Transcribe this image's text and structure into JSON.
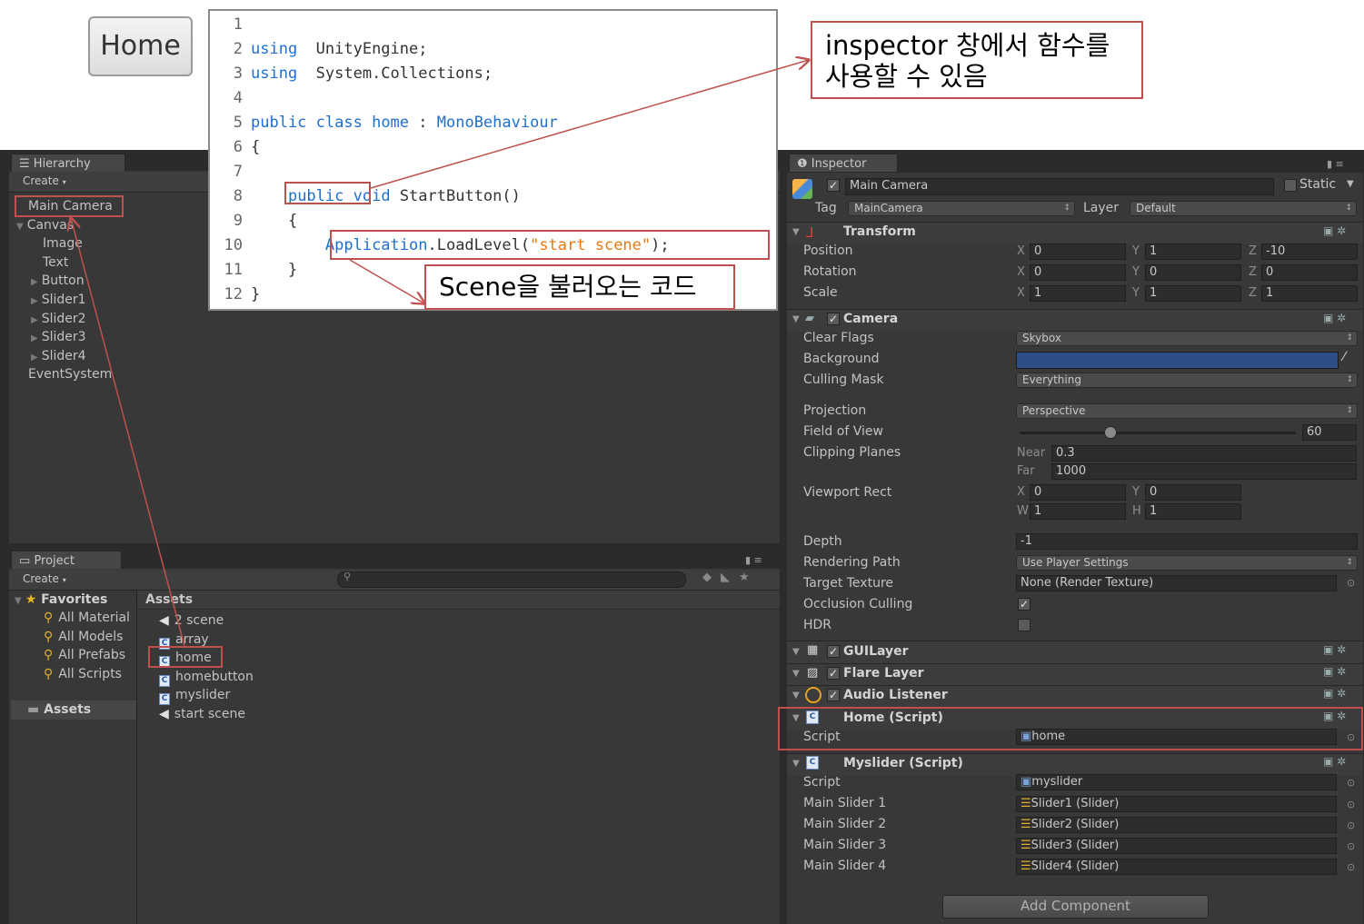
{
  "home_button": {
    "label": "Home"
  },
  "code": {
    "lines": [
      {
        "n": "1",
        "parts": []
      },
      {
        "n": "2",
        "parts": [
          [
            "kw",
            "using"
          ],
          [
            "",
            "  UnityEngine;"
          ]
        ]
      },
      {
        "n": "3",
        "parts": [
          [
            "kw",
            "using"
          ],
          [
            "",
            "  System.Collections;"
          ]
        ]
      },
      {
        "n": "4",
        "parts": []
      },
      {
        "n": "5",
        "parts": [
          [
            "kw",
            "public class"
          ],
          [
            "",
            " "
          ],
          [
            "ty",
            "home"
          ],
          [
            "",
            " : "
          ],
          [
            "ty",
            "MonoBehaviour"
          ]
        ]
      },
      {
        "n": "6",
        "parts": [
          [
            "",
            "{"
          ]
        ]
      },
      {
        "n": "7",
        "parts": []
      },
      {
        "n": "8",
        "parts": [
          [
            "",
            "    "
          ],
          [
            "kw",
            "public"
          ],
          [
            "",
            " "
          ],
          [
            "kw",
            "void"
          ],
          [
            "",
            " StartButton()"
          ]
        ]
      },
      {
        "n": "9",
        "parts": [
          [
            "",
            "    {"
          ]
        ]
      },
      {
        "n": "10",
        "parts": [
          [
            "",
            "        "
          ],
          [
            "ty",
            "Application"
          ],
          [
            "",
            ".LoadLevel("
          ],
          [
            "str",
            "\"start scene\""
          ],
          [
            "",
            ");"
          ]
        ]
      },
      {
        "n": "11",
        "parts": [
          [
            "",
            "    }"
          ]
        ]
      },
      {
        "n": "12",
        "parts": [
          [
            "",
            "}"
          ]
        ]
      }
    ]
  },
  "notes": {
    "inspector_note": "inspector 창에서 함수를\n사용할 수 있음",
    "scene_note": "Scene을 불러오는 코드"
  },
  "hierarchy": {
    "tab": "Hierarchy",
    "create": "Create",
    "items": [
      {
        "label": "Main Camera",
        "indent": 0,
        "arrow": ""
      },
      {
        "label": "Canvas",
        "indent": 0,
        "arrow": "▼"
      },
      {
        "label": "Image",
        "indent": 1,
        "arrow": ""
      },
      {
        "label": "Text",
        "indent": 1,
        "arrow": ""
      },
      {
        "label": "Button",
        "indent": 1,
        "arrow": "▶"
      },
      {
        "label": "Slider1",
        "indent": 1,
        "arrow": "▶"
      },
      {
        "label": "Slider2",
        "indent": 1,
        "arrow": "▶"
      },
      {
        "label": "Slider3",
        "indent": 1,
        "arrow": "▶"
      },
      {
        "label": "Slider4",
        "indent": 1,
        "arrow": "▶"
      },
      {
        "label": "EventSystem",
        "indent": 0,
        "arrow": ""
      }
    ]
  },
  "project": {
    "tab": "Project",
    "create": "Create",
    "favorites_label": "Favorites",
    "favorites": [
      "All Material",
      "All Models",
      "All Prefabs",
      "All Scripts"
    ],
    "assets_label": "Assets",
    "assets_header": "Assets",
    "assets": [
      {
        "label": "2 scene",
        "type": "scene"
      },
      {
        "label": "array",
        "type": "script"
      },
      {
        "label": "home",
        "type": "script"
      },
      {
        "label": "homebutton",
        "type": "script"
      },
      {
        "label": "myslider",
        "type": "script"
      },
      {
        "label": "start scene",
        "type": "scene"
      }
    ]
  },
  "inspector": {
    "tab": "Inspector",
    "object_name": "Main Camera",
    "static_label": "Static",
    "tag_label": "Tag",
    "tag_value": "MainCamera",
    "layer_label": "Layer",
    "layer_value": "Default",
    "transform": {
      "title": "Transform",
      "rows": [
        {
          "label": "Position",
          "x": "0",
          "y": "1",
          "z": "-10"
        },
        {
          "label": "Rotation",
          "x": "0",
          "y": "0",
          "z": "0"
        },
        {
          "label": "Scale",
          "x": "1",
          "y": "1",
          "z": "1"
        }
      ]
    },
    "camera": {
      "title": "Camera",
      "clear_flags_label": "Clear Flags",
      "clear_flags": "Skybox",
      "background_label": "Background",
      "background_color": "#2b4f86",
      "culling_mask_label": "Culling Mask",
      "culling_mask": "Everything",
      "projection_label": "Projection",
      "projection": "Perspective",
      "fov_label": "Field of View",
      "fov": "60",
      "clipping_label": "Clipping Planes",
      "near_label": "Near",
      "near": "0.3",
      "far_label": "Far",
      "far": "1000",
      "viewport_label": "Viewport Rect",
      "vx": "0",
      "vy": "0",
      "vw": "1",
      "vh": "1",
      "depth_label": "Depth",
      "depth": "-1",
      "rendering_path_label": "Rendering Path",
      "rendering_path": "Use Player Settings",
      "target_texture_label": "Target Texture",
      "target_texture": "None (Render Texture)",
      "occlusion_label": "Occlusion Culling",
      "hdr_label": "HDR"
    },
    "guilayer": "GUILayer",
    "flare_layer": "Flare Layer",
    "audio_listener": "Audio Listener",
    "home_script": {
      "title": "Home (Script)",
      "script_label": "Script",
      "script_value": "home"
    },
    "myslider_script": {
      "title": "Myslider (Script)",
      "script_label": "Script",
      "script_value": "myslider",
      "rows": [
        {
          "label": "Main Slider 1",
          "value": "Slider1 (Slider)"
        },
        {
          "label": "Main Slider 2",
          "value": "Slider2 (Slider)"
        },
        {
          "label": "Main Slider 3",
          "value": "Slider3 (Slider)"
        },
        {
          "label": "Main Slider 4",
          "value": "Slider4 (Slider)"
        }
      ]
    },
    "add_component": "Add Component"
  },
  "colors": {
    "annotation_red": "#c0504d",
    "keyword_blue": "#1f6fd1",
    "string_orange": "#e37a14"
  }
}
